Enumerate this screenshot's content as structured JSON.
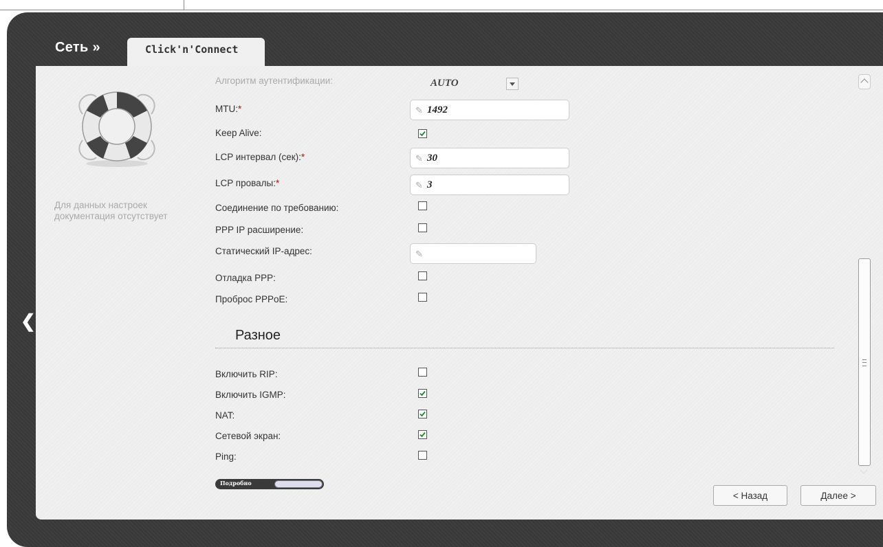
{
  "header": {
    "title": "Сеть »",
    "tab_label": "Click'n'Connect"
  },
  "help": {
    "text": "Для данных настроек документация отсутствует"
  },
  "fields": {
    "auth_algo": {
      "label": "Алгоритм аутентификации:",
      "value": "AUTO"
    },
    "mtu": {
      "label": "MTU:",
      "value": "1492"
    },
    "keep_alive": {
      "label": "Keep Alive:",
      "checked": true
    },
    "lcp_interval": {
      "label": "LCP интервал (сек):",
      "value": "30"
    },
    "lcp_failures": {
      "label": "LCP провалы:",
      "value": "3"
    },
    "on_demand": {
      "label": "Соединение по требованию:",
      "checked": false
    },
    "ppp_ip_ext": {
      "label": "PPP IP расширение:",
      "checked": false
    },
    "static_ip": {
      "label": "Статический IP-адрес:",
      "value": ""
    },
    "ppp_debug": {
      "label": "Отладка PPP:",
      "checked": false
    },
    "pppoe_pass": {
      "label": "Проброс PPPoE:",
      "checked": false
    }
  },
  "misc": {
    "title": "Разное",
    "rip": {
      "label": "Включить RIP:",
      "checked": false
    },
    "igmp": {
      "label": "Включить IGMP:",
      "checked": true
    },
    "nat": {
      "label": "NAT:",
      "checked": true
    },
    "firewall": {
      "label": "Сетевой экран:",
      "checked": true
    },
    "ping": {
      "label": "Ping:",
      "checked": false
    }
  },
  "required_mark": "*",
  "details_toggle": {
    "label": "Подробно",
    "on": false
  },
  "buttons": {
    "back": "< Назад",
    "next": "Далее >"
  },
  "colors": {
    "frame": "#3a3a3a",
    "panel": "#f0f0f0",
    "check": "#1a8a2a",
    "required": "#e00000"
  },
  "icons": {
    "help_image": "lifebuoy-icon",
    "nav_back": "chevron-left-icon",
    "edit": "pencil-icon"
  }
}
